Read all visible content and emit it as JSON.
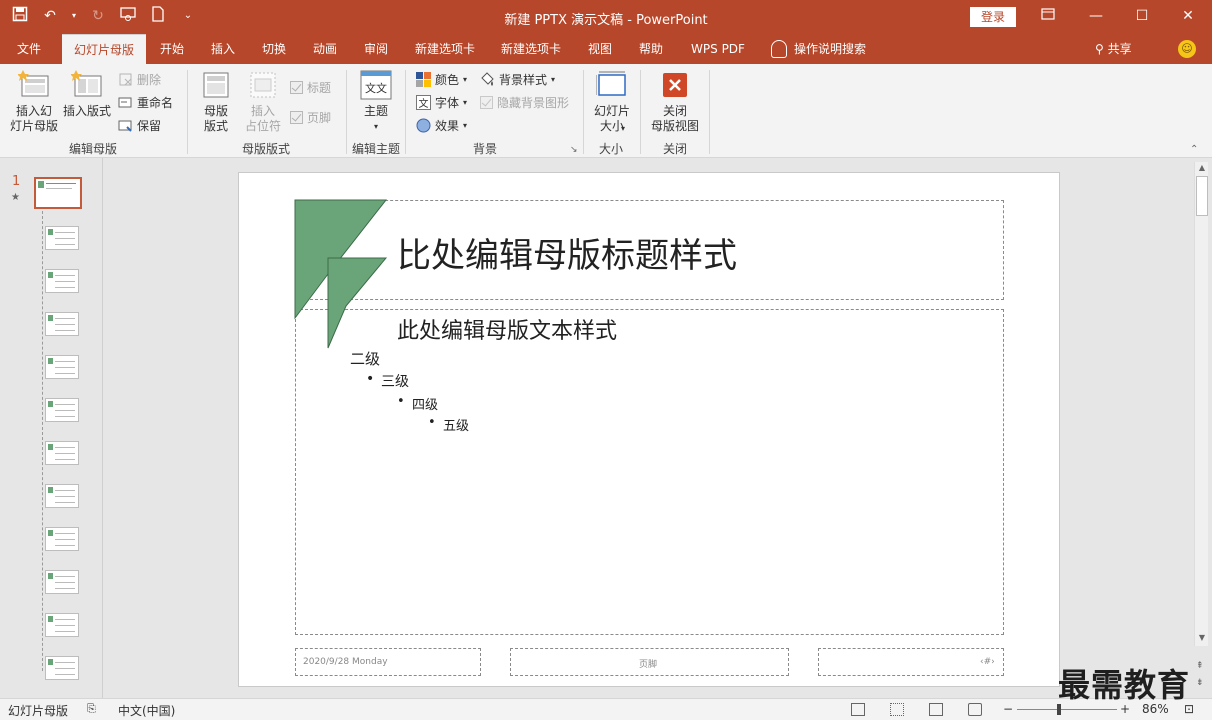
{
  "window": {
    "title": "新建 PPTX 演示文稿  -  PowerPoint",
    "signin_label": "登录",
    "buttons": [
      "restore-ribbon",
      "minimize",
      "maximize",
      "close"
    ]
  },
  "quick_access": [
    "save-icon",
    "undo-icon",
    "redo-icon",
    "presentation-icon",
    "new-file-icon",
    "customize-icon"
  ],
  "tabs": [
    {
      "label": "文件",
      "active": false
    },
    {
      "label": "幻灯片母版",
      "active": true
    },
    {
      "label": "开始",
      "active": false
    },
    {
      "label": "插入",
      "active": false
    },
    {
      "label": "切换",
      "active": false
    },
    {
      "label": "动画",
      "active": false
    },
    {
      "label": "审阅",
      "active": false
    },
    {
      "label": "新建选项卡",
      "active": false
    },
    {
      "label": "新建选项卡",
      "active": false
    },
    {
      "label": "视图",
      "active": false
    },
    {
      "label": "帮助",
      "active": false
    },
    {
      "label": "WPS PDF",
      "active": false
    }
  ],
  "tell_me": "操作说明搜索",
  "share_label": "共享",
  "ribbon": {
    "edit_master": {
      "label": "编辑母版",
      "insert_slide_master": "插入幻\n灯片母版",
      "insert_layout": "插入版式",
      "delete": "删除",
      "rename": "重命名",
      "preserve": "保留"
    },
    "master_layout": {
      "label": "母版版式",
      "master_layout_btn": "母版\n版式",
      "insert_placeholder": "插入\n占位符",
      "title_chk": "标题",
      "footer_chk": "页脚"
    },
    "edit_theme": {
      "label": "编辑主题",
      "themes": "主题",
      "theme_icon_text": "文文"
    },
    "background": {
      "label": "背景",
      "colors": "颜色",
      "fonts": "字体",
      "effects": "效果",
      "bg_styles": "背景样式",
      "hide_bg": "隐藏背景图形"
    },
    "size": {
      "label": "大小",
      "slide_size": "幻灯片\n大小"
    },
    "close": {
      "label": "关闭",
      "close_master": "关闭\n母版视图"
    }
  },
  "thumbnails": {
    "master_number": "1",
    "master_star": "★",
    "layout_count": 11
  },
  "slide": {
    "title": "比处编辑母版标题样式",
    "level1": "此处编辑母版文本样式",
    "level2": "二级",
    "level3": "三级",
    "level4": "四级",
    "level5": "五级",
    "date": "2020/9/28 Monday",
    "footer": "页脚",
    "page_number": "‹#›"
  },
  "status": {
    "view_name": "幻灯片母版",
    "language": "中文(中国)",
    "zoom": "86%"
  },
  "watermark": "最需教育",
  "colors": {
    "accent": "#b7472a",
    "logo_green": "#6aa57a"
  }
}
